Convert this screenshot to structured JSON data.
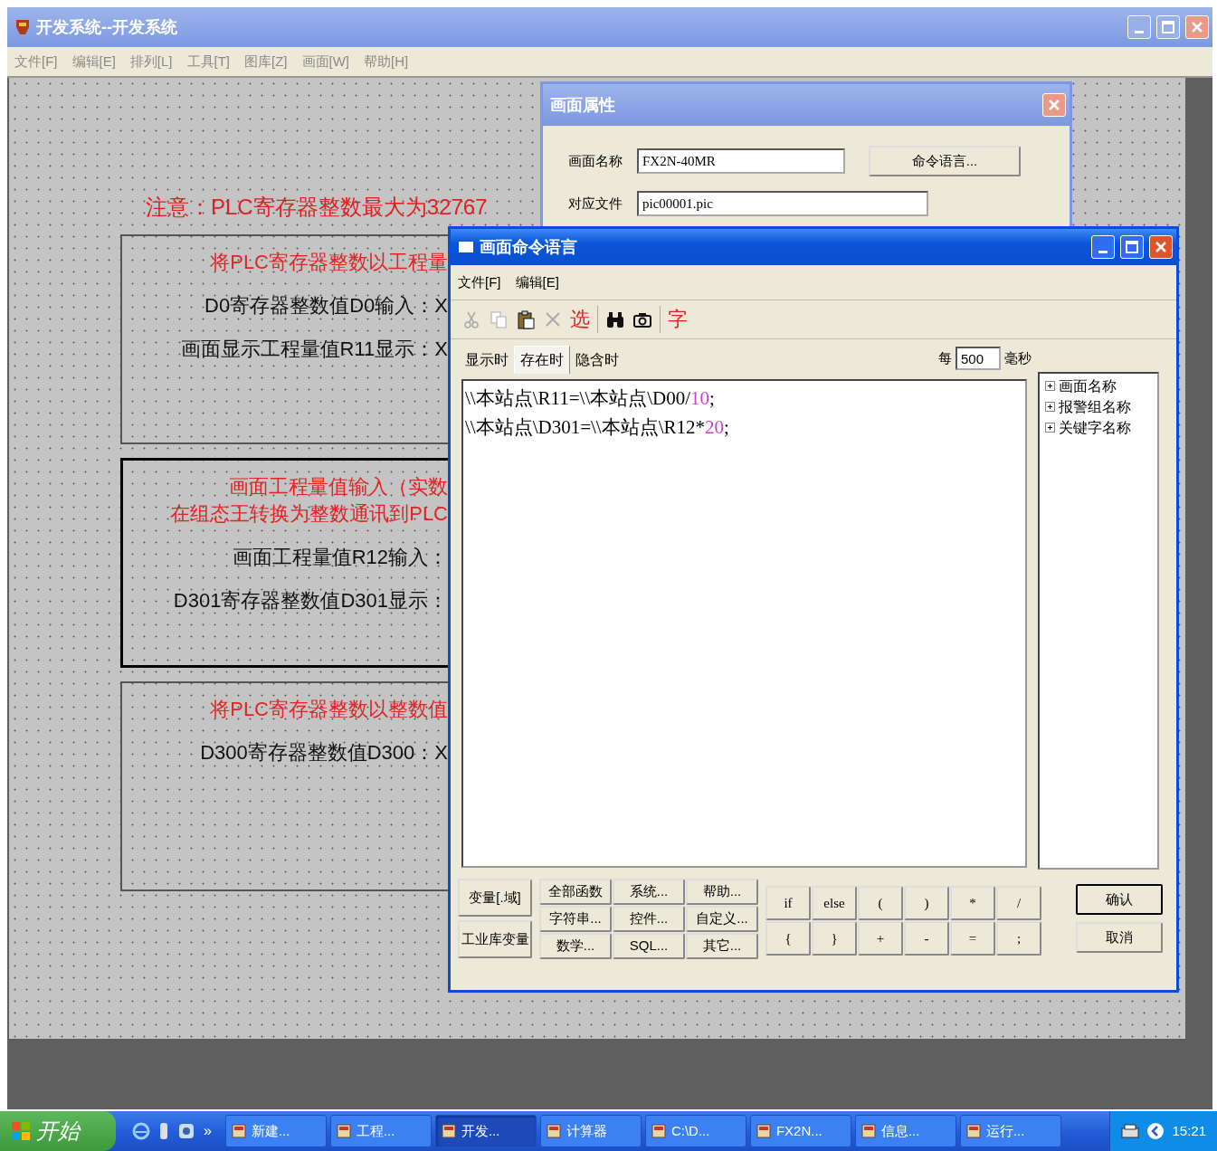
{
  "main_window": {
    "title": "开发系统--开发系统",
    "menu": [
      "文件[F]",
      "编辑[E]",
      "排列[L]",
      "工具[T]",
      "图库[Z]",
      "画面[W]",
      "帮助[H]"
    ]
  },
  "canvas": {
    "note": "注意：PLC寄存器整数最大为32767",
    "groups": [
      {
        "selected": false,
        "lines": [
          {
            "kind": "heading",
            "text": "将PLC寄存器整数以工程量"
          },
          {
            "kind": "label",
            "text": "D0寄存器整数值D0输入：X"
          },
          {
            "kind": "label",
            "text": "画面显示工程量值R11显示：X"
          }
        ]
      },
      {
        "selected": true,
        "lines": [
          {
            "kind": "heading",
            "text": "画面工程量值输入（实数"
          },
          {
            "kind": "heading",
            "text": "在组态王转换为整数通讯到PLC"
          },
          {
            "kind": "label",
            "text": "画面工程量值R12输入："
          },
          {
            "kind": "label",
            "text": "D301寄存器整数值D301显示："
          }
        ]
      },
      {
        "selected": false,
        "lines": [
          {
            "kind": "heading",
            "text": "将PLC寄存器整数以整数值"
          },
          {
            "kind": "label",
            "text": "D300寄存器整数值D300：X"
          }
        ]
      }
    ]
  },
  "properties_dialog": {
    "title": "画面属性",
    "fields": [
      {
        "label": "画面名称",
        "value": "FX2N-40MR"
      },
      {
        "label": "对应文件",
        "value": "pic00001.pic"
      }
    ],
    "command_button": "命令语言..."
  },
  "command_dialog": {
    "title": "画面命令语言",
    "menu": [
      "文件[F]",
      "编辑[E]"
    ],
    "toolbar": [
      [
        {
          "kind": "cut",
          "disabled": true
        },
        {
          "kind": "copy",
          "disabled": true
        },
        {
          "kind": "paste",
          "disabled": false
        },
        {
          "kind": "delete",
          "disabled": true
        },
        {
          "kind": "text",
          "label": "选",
          "disabled": false
        }
      ],
      [
        {
          "kind": "find",
          "disabled": false
        },
        {
          "kind": "camera",
          "disabled": false
        }
      ],
      [
        {
          "kind": "text",
          "label": "字",
          "disabled": false
        }
      ]
    ],
    "tabs": [
      {
        "label": "显示时",
        "selected": false
      },
      {
        "label": "存在时",
        "selected": true
      },
      {
        "label": "隐含时",
        "selected": false
      }
    ],
    "interval": {
      "prefix": "每",
      "value": "500",
      "unit": "毫秒"
    },
    "code": [
      {
        "segments": [
          {
            "kind": "plain",
            "text": "\\\\本站点\\R11=\\\\本站点\\D00/"
          },
          {
            "kind": "number",
            "text": "10"
          },
          {
            "kind": "plain",
            "text": ";"
          }
        ]
      },
      {
        "segments": [
          {
            "kind": "plain",
            "text": "\\\\本站点\\D301=\\\\本站点\\R12*"
          },
          {
            "kind": "number",
            "text": "20"
          },
          {
            "kind": "plain",
            "text": ";"
          }
        ]
      }
    ],
    "tree": [
      {
        "label": "画面名称",
        "expanded": false
      },
      {
        "label": "报警组名称",
        "expanded": false
      },
      {
        "label": "关键字名称",
        "expanded": false
      }
    ],
    "variable_buttons": [
      "变量[.域]",
      "工业库变量"
    ],
    "function_buttons": [
      "全部函数",
      "系统...",
      "帮助...",
      "字符串...",
      "控件...",
      "自定义...",
      "数学...",
      "SQL...",
      "其它..."
    ],
    "operator_buttons": [
      "if",
      "else",
      "(",
      ")",
      "*",
      "/",
      "{",
      "}",
      "+",
      "-",
      "=",
      ";"
    ],
    "action_buttons": [
      "确认",
      "取消"
    ]
  },
  "taskbar": {
    "start": "开始",
    "overflow": "»",
    "tasks": [
      {
        "label": "新建...",
        "selected": false
      },
      {
        "label": "工程...",
        "selected": false
      },
      {
        "label": "开发...",
        "selected": true
      },
      {
        "label": "计算器",
        "selected": false
      },
      {
        "label": "C:\\D...",
        "selected": false
      },
      {
        "label": "FX2N...",
        "selected": false
      },
      {
        "label": "信息...",
        "selected": false
      },
      {
        "label": "运行...",
        "selected": false
      }
    ],
    "clock": "15:21"
  }
}
